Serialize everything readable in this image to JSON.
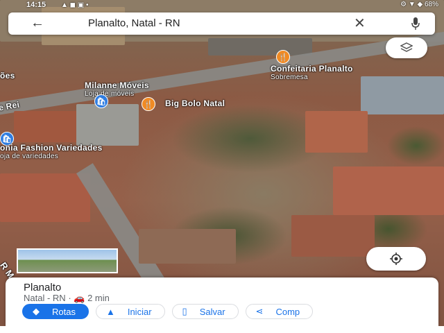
{
  "status_bar": {
    "time": "14:15",
    "left_icons": "▲ ◼ ▣ •",
    "right_icons": "⚙ ▼ ◆ 68%"
  },
  "search": {
    "query": "Planalto, Natal - RN",
    "back_icon": "arrow-left",
    "clear_icon": "close",
    "mic_icon": "microphone"
  },
  "map": {
    "labels": {
      "confeitaria_name": "Confeitaria Planalto",
      "confeitaria_type": "Sobremesa",
      "milanne_name": "Milanne Móveis",
      "milanne_type": "Loja de móveis",
      "bigbolo_name": "Big Bolo Natal",
      "fashion_name": "onia Fashion Variedades",
      "fashion_type": "oja de variedades",
      "street_rei": "e Rei",
      "edge_top": "ões",
      "edge_bottom": "R M"
    }
  },
  "place": {
    "name": "Planalto",
    "region": "Natal - RN",
    "separator": "·",
    "drive_time": "2 min"
  },
  "actions": [
    {
      "label": "Rotas",
      "icon": "directions"
    },
    {
      "label": "Iniciar",
      "icon": "navigation"
    },
    {
      "label": "Salvar",
      "icon": "bookmark"
    },
    {
      "label": "Comp",
      "icon": "share"
    }
  ],
  "colors": {
    "accent": "#1a73e8",
    "pin_food": "#f08a24",
    "pin_shop": "#2f7de1"
  }
}
